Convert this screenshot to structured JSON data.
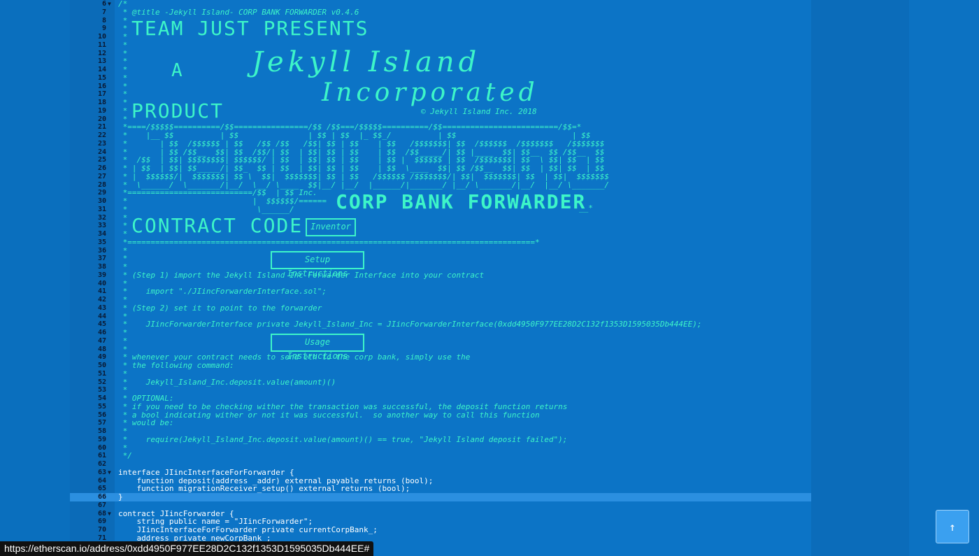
{
  "code": {
    "lines": [
      {
        "n": "6",
        "fold": "▼",
        "text": "/*"
      },
      {
        "n": "7",
        "text": " * @title -Jekyll Island- CORP BANK FORWARDER v0.4.6"
      },
      {
        "n": "8",
        "text": " *"
      },
      {
        "n": "9",
        "text": " *"
      },
      {
        "n": "10",
        "text": " *"
      },
      {
        "n": "11",
        "text": " *"
      },
      {
        "n": "12",
        "text": " *"
      },
      {
        "n": "13",
        "text": " *"
      },
      {
        "n": "14",
        "text": " *"
      },
      {
        "n": "15",
        "text": " *"
      },
      {
        "n": "16",
        "text": " *"
      },
      {
        "n": "17",
        "text": " *"
      },
      {
        "n": "18",
        "text": " *"
      },
      {
        "n": "19",
        "text": " *"
      },
      {
        "n": "20",
        "text": " *"
      },
      {
        "n": "21",
        "text": " *====/$$$$$==========/$$================/$$ /$$===/$$$$$==========/$$=========================/$$=*"
      },
      {
        "n": "22",
        "text": " *    |__ $$          | $$               | $$ | $$  |_ $$_/          | $$                         | $$"
      },
      {
        "n": "23",
        "text": " *       | $$  /$$$$$$ | $$   /$$ /$$   /$$| $$ | $$    | $$   /$$$$$$$| $$  /$$$$$$  /$$$$$$$   /$$$$$$$"
      },
      {
        "n": "24",
        "text": " *       | $$ /$$__  $$| $$  /$$/| $$  | $$| $$ | $$    | $$  /$$_____/| $$ |____  $$| $$__  $$ /$$__  $$"
      },
      {
        "n": "25",
        "text": " *  /$$  | $$| $$$$$$$$| $$$$$$/ | $$  | $$| $$ | $$    | $$ |  $$$$$$ | $$  /$$$$$$$| $$  \\ $$| $$  | $$"
      },
      {
        "n": "26",
        "text": " * | $$  | $$| $$_____/| $$_  $$ | $$  | $$| $$ | $$    | $$  \\____  $$| $$ /$$__  $$| $$  | $$| $$  | $$"
      },
      {
        "n": "27",
        "text": " * |  $$$$$$/|  $$$$$$$| $$ \\  $$|  $$$$$$$| $$ | $$   /$$$$$$ /$$$$$$$/| $$|  $$$$$$$| $$  | $$|  $$$$$$$"
      },
      {
        "n": "28",
        "text": " *  \\______/  \\_______/|__/  \\__/ \\____  $$|__/ |__/  |______/|_______/ |__/ \\_______/|__/  |__/ \\_______/"
      },
      {
        "n": "29",
        "text": " *===========================/$$  | $$ Inc."
      },
      {
        "n": "30",
        "text": " *                           |  $$$$$$/======"
      },
      {
        "n": "31",
        "text": " *                            \\______/"
      },
      {
        "n": "32",
        "text": " *"
      },
      {
        "n": "33",
        "text": " *"
      },
      {
        "n": "34",
        "text": " *"
      },
      {
        "n": "35",
        "text": " *========================================================================================*"
      },
      {
        "n": "36",
        "text": " *"
      },
      {
        "n": "37",
        "text": " *"
      },
      {
        "n": "38",
        "text": " *"
      },
      {
        "n": "39",
        "text": " * (Step 1) import the Jekyll Island Inc Forwarder Interface into your contract"
      },
      {
        "n": "40",
        "text": " *"
      },
      {
        "n": "41",
        "text": " *    import \"./JIincForwarderInterface.sol\";"
      },
      {
        "n": "42",
        "text": " *"
      },
      {
        "n": "43",
        "text": " * (Step 2) set it to point to the forwarder"
      },
      {
        "n": "44",
        "text": " *"
      },
      {
        "n": "45",
        "text": " *    JIincForwarderInterface private Jekyll_Island_Inc = JIincForwarderInterface(0xdd4950F977EE28D2C132f1353D1595035Db444EE);"
      },
      {
        "n": "46",
        "text": " *"
      },
      {
        "n": "47",
        "text": " *"
      },
      {
        "n": "48",
        "text": " *"
      },
      {
        "n": "49",
        "text": " * whenever your contract needs to send eth to the corp bank, simply use the"
      },
      {
        "n": "50",
        "text": " * the following command:"
      },
      {
        "n": "51",
        "text": " *"
      },
      {
        "n": "52",
        "text": " *    Jekyll_Island_Inc.deposit.value(amount)()"
      },
      {
        "n": "53",
        "text": " *"
      },
      {
        "n": "54",
        "text": " * OPTIONAL:"
      },
      {
        "n": "55",
        "text": " * if you need to be checking wither the transaction was successful, the deposit function returns"
      },
      {
        "n": "56",
        "text": " * a bool indicating wither or not it was successful.  so another way to call this function"
      },
      {
        "n": "57",
        "text": " * would be:"
      },
      {
        "n": "58",
        "text": " *"
      },
      {
        "n": "59",
        "text": " *    require(Jekyll_Island_Inc.deposit.value(amount)() == true, \"Jekyll Island deposit failed\");"
      },
      {
        "n": "60",
        "text": " *"
      },
      {
        "n": "61",
        "text": " */"
      },
      {
        "n": "62",
        "text": ""
      },
      {
        "n": "63",
        "fold": "▼",
        "text": "interface JIincInterfaceForForwarder {",
        "code": true
      },
      {
        "n": "64",
        "text": "    function deposit(address _addr) external payable returns (bool);",
        "code": true
      },
      {
        "n": "65",
        "text": "    function migrationReceiver_setup() external returns (bool);",
        "code": true
      },
      {
        "n": "66",
        "text": "}",
        "code": true,
        "active": true
      },
      {
        "n": "67",
        "text": "",
        "code": true
      },
      {
        "n": "68",
        "fold": "▼",
        "text": "contract JIincForwarder {",
        "code": true
      },
      {
        "n": "69",
        "text": "    string public name = \"JIincForwarder\";",
        "code": true
      },
      {
        "n": "70",
        "text": "    JIincInterfaceForForwarder private currentCorpBank_;",
        "code": true
      },
      {
        "n": "71",
        "text": "    address private newCorpBank_;",
        "code": true
      }
    ]
  },
  "banners": {
    "team_just": "TEAM JUST PRESENTS",
    "a": "A",
    "product": "PRODUCT",
    "script_line1": "Jekyll Island",
    "script_line2": "Incorporated",
    "tm": "™",
    "copyright": "© Jekyll Island Inc. 2018",
    "corp_bank": "CORP BANK FORWARDER",
    "contract_code": "CONTRACT CODE",
    "inventor": "Inventor",
    "setup_instructions": "Setup Instructions",
    "usage_instructions": "Usage Instructions",
    "end_marks": "__*"
  },
  "status_bar": {
    "url": "https://etherscan.io/address/0xdd4950F977EE28D2C132f1353D1595035Db444EE#"
  },
  "scroll_top": {
    "icon": "↑"
  }
}
